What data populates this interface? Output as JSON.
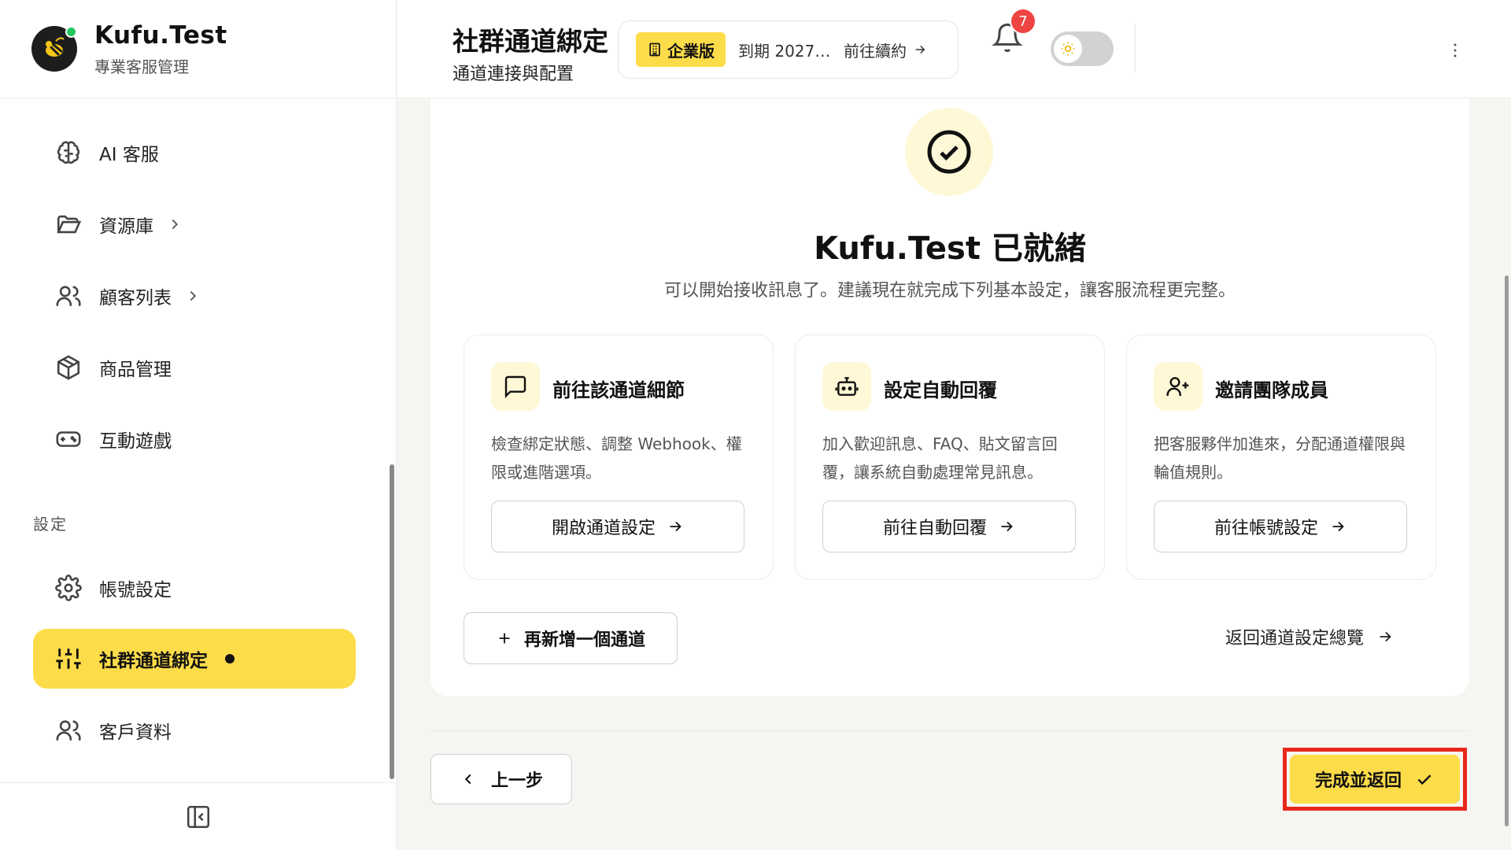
{
  "brand": {
    "name": "Kufu.Test",
    "subtitle": "專業客服管理"
  },
  "sidebar": {
    "items": [
      {
        "label": "AI 客服",
        "icon": "brain-icon"
      },
      {
        "label": "資源庫",
        "icon": "folder-icon",
        "has_submenu": true
      },
      {
        "label": "顧客列表",
        "icon": "users-icon",
        "has_submenu": true
      },
      {
        "label": "商品管理",
        "icon": "package-icon"
      },
      {
        "label": "互動遊戲",
        "icon": "gamepad-icon"
      },
      {
        "label": "帳號設定",
        "icon": "gear-icon"
      },
      {
        "label": "社群通道綁定",
        "icon": "sliders-icon",
        "active": true
      },
      {
        "label": "客戶資料",
        "icon": "users-icon"
      }
    ],
    "section_label": "設定"
  },
  "header": {
    "title": "社群通道綁定",
    "subtitle": "通道連接與配置",
    "plan_badge": "企業版",
    "plan_expiry": "到期 2027…",
    "renew_label": "前往續約",
    "notification_count": "7"
  },
  "main": {
    "ready_title": "Kufu.Test 已就緒",
    "ready_subtitle": "可以開始接收訊息了。建議現在就完成下列基本設定，讓客服流程更完整。",
    "cards": [
      {
        "title": "前往該通道細節",
        "desc": "檢查綁定狀態、調整 Webhook、權限或進階選項。",
        "button": "開啟通道設定",
        "icon": "message-square-icon"
      },
      {
        "title": "設定自動回覆",
        "desc": "加入歡迎訊息、FAQ、貼文留言回覆，讓系統自動處理常見訊息。",
        "button": "前往自動回覆",
        "icon": "bot-icon"
      },
      {
        "title": "邀請團隊成員",
        "desc": "把客服夥伴加進來，分配通道權限與輪值規則。",
        "button": "前往帳號設定",
        "icon": "user-plus-icon"
      }
    ],
    "add_channel": "再新增一個通道",
    "back_overview": "返回通道設定總覽"
  },
  "footer": {
    "prev": "上一步",
    "finish": "完成並返回"
  },
  "colors": {
    "accent": "#fddc4a",
    "accent_soft": "#fef8d6",
    "highlight_border": "#e8281b",
    "badge_red": "#ef4444"
  }
}
